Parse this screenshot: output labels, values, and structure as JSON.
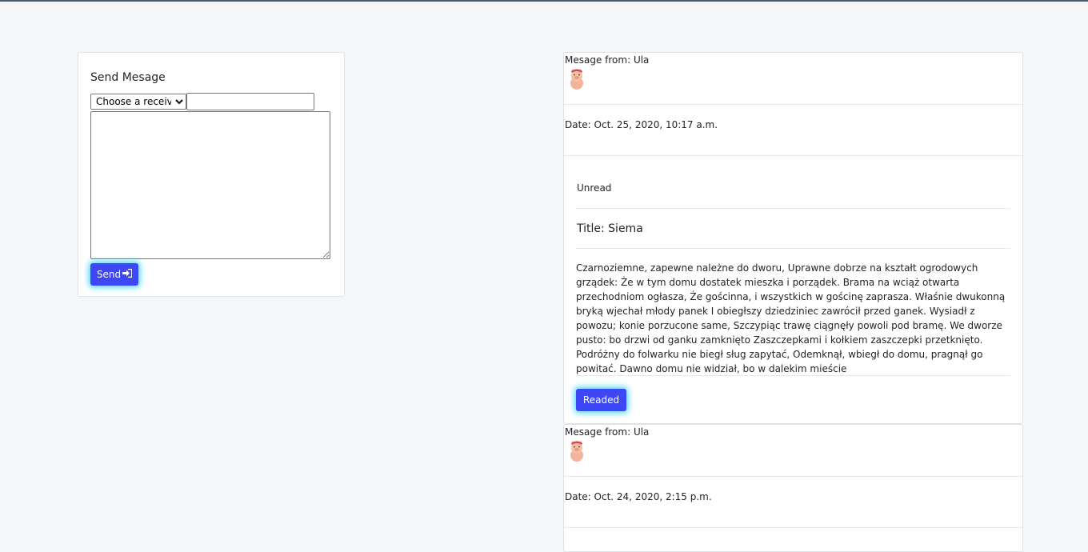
{
  "send_panel": {
    "title": "Send Mesage",
    "receiver_selected": "Choose a receiver",
    "title_input_value": "",
    "body_value": "",
    "send_label": "Send",
    "send_icon": "sign-in-icon"
  },
  "messages": [
    {
      "from": "Mesage from: Ula",
      "avatar_icon": "pig-avatar",
      "date": "Date: Oct. 25, 2020, 10:17 a.m.",
      "status": "Unread",
      "title": "Title: Siema",
      "content": "Czarnoziemne, zapewne należne do dworu, Uprawne dobrze na kształt ogrodowych grządek: Że w tym domu dostatek mieszka i porządek. Brama na wciąż otwarta przechodniom ogłasza, Że gościnna, i wszystkich w gościnę zaprasza. Właśnie dwukonną bryką wjechał młody panek I obiegłszy dziedziniec zawrócił przed ganek. Wysiadł z powozu; konie porzucone same, Szczypiąc trawę ciągnęły powoli pod bramę. We dworze pusto: bo drzwi od ganku zamknięto Zaszczepkami i kołkiem zaszczepki przetknięto. Podróżny do folwarku nie biegł sług zapytać, Odemknął, wbiegł do domu, pragnął go powitać. Dawno domu nie widział, bo w dalekim mieście",
      "button_label": "Readed"
    },
    {
      "from": "Mesage from: Ula",
      "avatar_icon": "pig-avatar",
      "date": "Date: Oct. 24, 2020, 2:15 p.m."
    }
  ],
  "colors": {
    "primary_button": "#3d47f5",
    "button_glow": "#00c8ff",
    "background": "#f5f6f8"
  }
}
